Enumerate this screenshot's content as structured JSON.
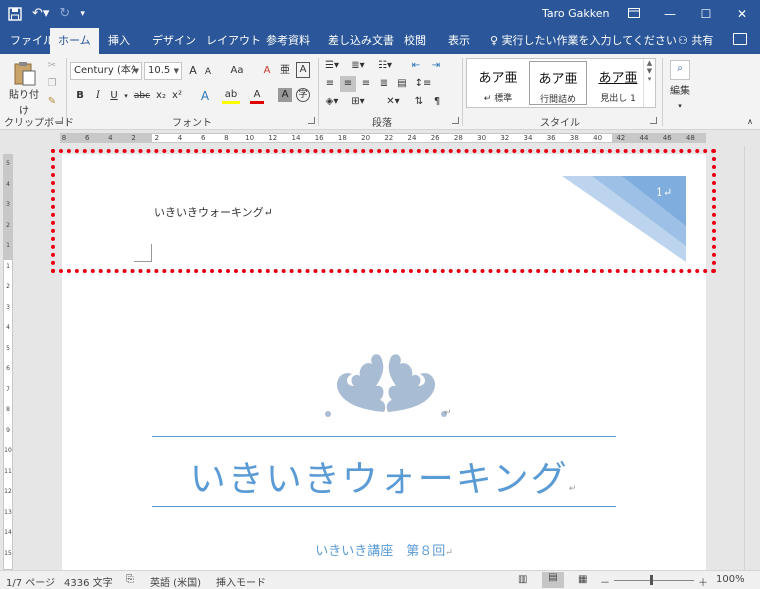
{
  "title_bar": {
    "save_icon": "save-icon",
    "undo_icon": "undo-icon",
    "redo_icon": "redo-icon",
    "customize_icon": "customize-qat-icon",
    "user_name": "Taro Gakken",
    "ribbon_display_icon": "ribbon-display-icon",
    "minimize_icon": "minimize-icon",
    "maximize_icon": "maximize-icon",
    "close_icon": "close-icon"
  },
  "tabs": [
    {
      "label": "ファイル"
    },
    {
      "label": "ホーム"
    },
    {
      "label": "挿入"
    },
    {
      "label": "デザイン"
    },
    {
      "label": "レイアウト"
    },
    {
      "label": "参考資料"
    },
    {
      "label": "差し込み文書"
    },
    {
      "label": "校閲"
    },
    {
      "label": "表示"
    }
  ],
  "tell_me": "実行したい作業を入力してください",
  "share": "共有",
  "ribbon": {
    "clipboard": {
      "paste": "貼り付け",
      "label": "クリップボード"
    },
    "font": {
      "font_name": "Century (本ﾀ",
      "font_size": "10.5",
      "grow": "A",
      "shrink": "A",
      "change_case": "Aa",
      "clear_format": "A",
      "phonetic": "亜",
      "char_border": "A",
      "bold": "B",
      "italic": "I",
      "underline": "U",
      "strike": "abc",
      "subscript": "x₂",
      "superscript": "x²",
      "effects": "A",
      "highlight": "ab",
      "font_color": "A",
      "char_shading": "A",
      "enclose": "字",
      "label": "フォント"
    },
    "paragraph": {
      "label": "段落"
    },
    "styles": {
      "items": [
        {
          "sample": "あア亜",
          "name": "↵ 標準"
        },
        {
          "sample": "あア亜",
          "name": "行間詰め"
        },
        {
          "sample": "あア亜",
          "name": "見出し 1"
        }
      ],
      "label": "スタイル"
    },
    "editing": {
      "label": "編集"
    }
  },
  "ruler": {
    "h_ticks": [
      "8",
      "6",
      "4",
      "2",
      "2",
      "4",
      "6",
      "8",
      "10",
      "12",
      "14",
      "16",
      "18",
      "20",
      "22",
      "24",
      "26",
      "28",
      "30",
      "32",
      "34",
      "36",
      "38",
      "40",
      "42",
      "44",
      "46",
      "48"
    ],
    "v_ticks": [
      "5",
      "4",
      "3",
      "2",
      "1",
      "1",
      "2",
      "3",
      "4",
      "5",
      "6",
      "7",
      "8",
      "9",
      "10",
      "11",
      "12",
      "13",
      "14",
      "15"
    ]
  },
  "document": {
    "header_text": "いきいきウォーキング↵",
    "page_number": "1↵",
    "main_title": "いきいきウォーキング",
    "subtitle": "いきいき講座　第８回",
    "para_mark": "↵"
  },
  "status_bar": {
    "page": "1/7 ページ",
    "words": "4336 文字",
    "language": "英語 (米国)",
    "mode": "挿入モード",
    "zoom": "100%",
    "zoom_minus": "－",
    "zoom_plus": "＋"
  },
  "colors": {
    "accent": "#2b579a",
    "title_blue": "#5b9bd5",
    "highlight_red": "#e60012"
  }
}
